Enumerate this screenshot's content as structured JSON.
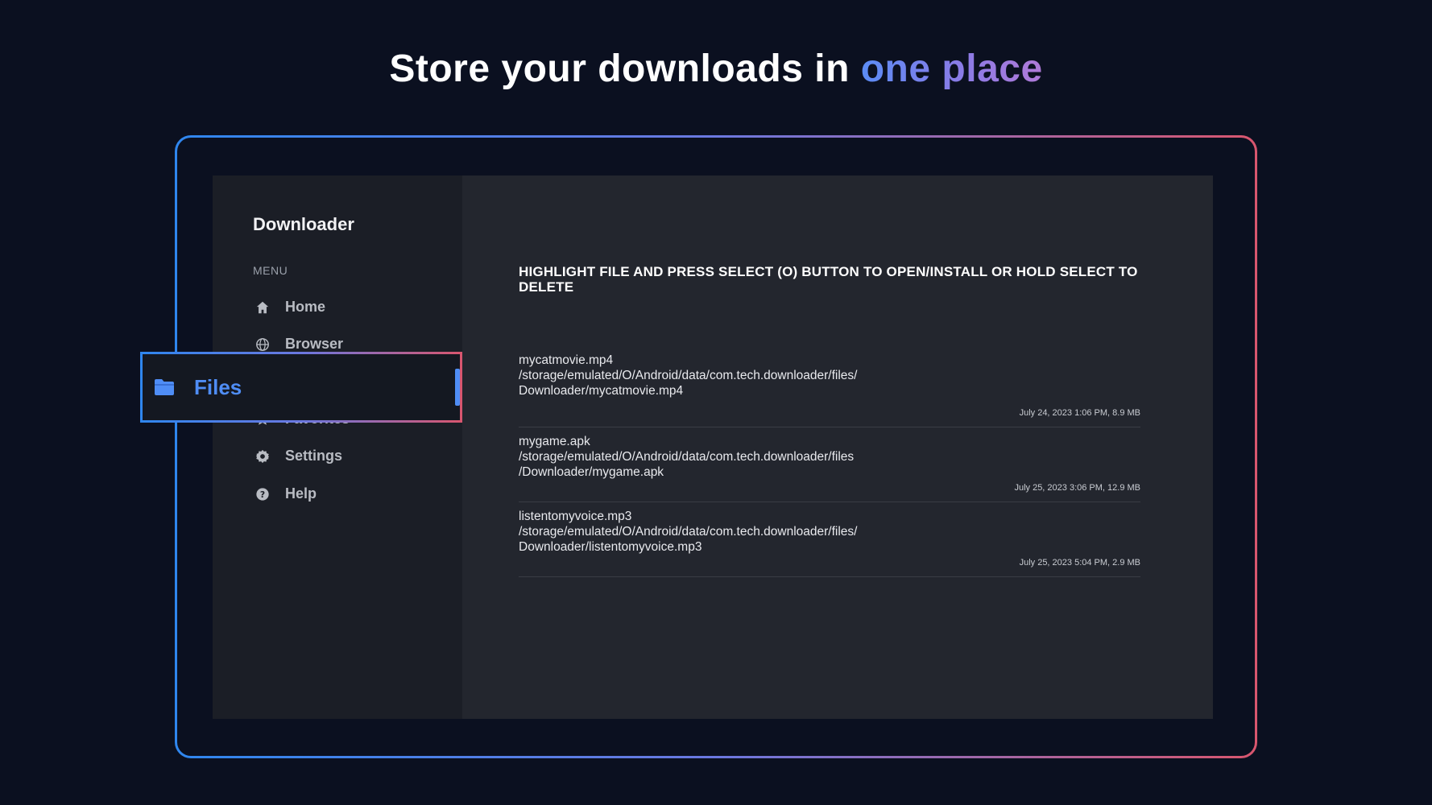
{
  "headline": {
    "prefix": "Store your downloads in",
    "accent": "one place"
  },
  "app": {
    "title": "Downloader",
    "menu_label": "MENU",
    "nav": [
      {
        "label": "Home",
        "icon": "home-icon"
      },
      {
        "label": "Browser",
        "icon": "globe-icon"
      },
      {
        "label": "Files",
        "icon": "folder-icon",
        "selected": true
      },
      {
        "label": "Favorites",
        "icon": "star-icon"
      },
      {
        "label": "Settings",
        "icon": "gear-icon"
      },
      {
        "label": "Help",
        "icon": "help-icon"
      }
    ]
  },
  "main": {
    "instructions": "HIGHLIGHT FILE AND PRESS SELECT (O) BUTTON TO OPEN/INSTALL OR HOLD SELECT TO DELETE",
    "files": [
      {
        "name": "mycatmovie.mp4",
        "path_line1": "/storage/emulated/O/Android/data/com.tech.downloader/files/",
        "path_line2": "Downloader/mycatmovie.mp4",
        "meta": "July 24, 2023 1:06 PM, 8.9 MB"
      },
      {
        "name": "mygame.apk",
        "path_line1": "/storage/emulated/O/Android/data/com.tech.downloader/files",
        "path_line2": "/Downloader/mygame.apk",
        "meta": "July 25, 2023 3:06 PM, 12.9 MB"
      },
      {
        "name": "listentomyvoice.mp3",
        "path_line1": "/storage/emulated/O/Android/data/com.tech.downloader/files/",
        "path_line2": "Downloader/listentomyvoice.mp3",
        "meta": "July 25, 2023 5:04 PM, 2.9 MB"
      }
    ]
  },
  "colors": {
    "background": "#0b1020",
    "accent_blue": "#4f8df5",
    "frame_gradient_start": "#2f86ee",
    "frame_gradient_end": "#d9566e"
  }
}
